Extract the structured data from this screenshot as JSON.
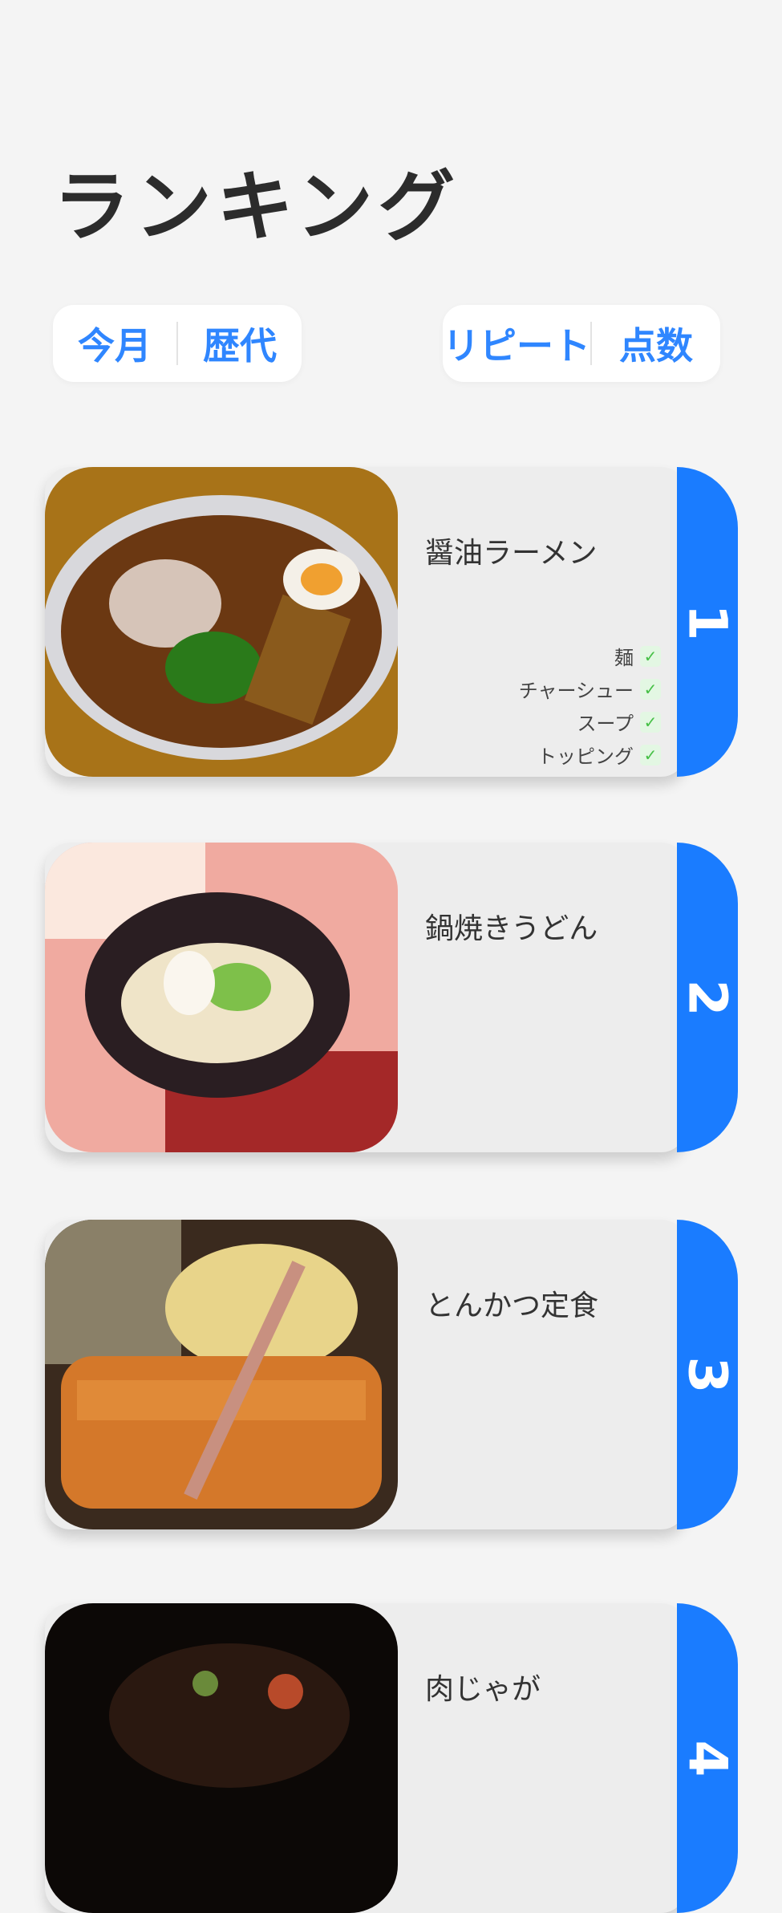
{
  "header": {
    "title": "ランキング"
  },
  "filters": {
    "period": [
      "今月",
      "歴代"
    ],
    "sort": [
      "リピート",
      "点数"
    ]
  },
  "ranking": [
    {
      "rank": "1",
      "name": "醤油ラーメン",
      "tags": [
        {
          "label": "麺"
        },
        {
          "label": "チャーシュー"
        },
        {
          "label": "スープ"
        },
        {
          "label": "トッピング"
        }
      ]
    },
    {
      "rank": "2",
      "name": "鍋焼きうどん"
    },
    {
      "rank": "3",
      "name": "とんかつ定食"
    },
    {
      "rank": "4",
      "name": "肉じゃが"
    }
  ],
  "colors": {
    "accent": "#1a7cff",
    "segment_text": "#2f86ff",
    "background": "#f4f4f4",
    "card": "#ededed",
    "check": "#46c046"
  }
}
